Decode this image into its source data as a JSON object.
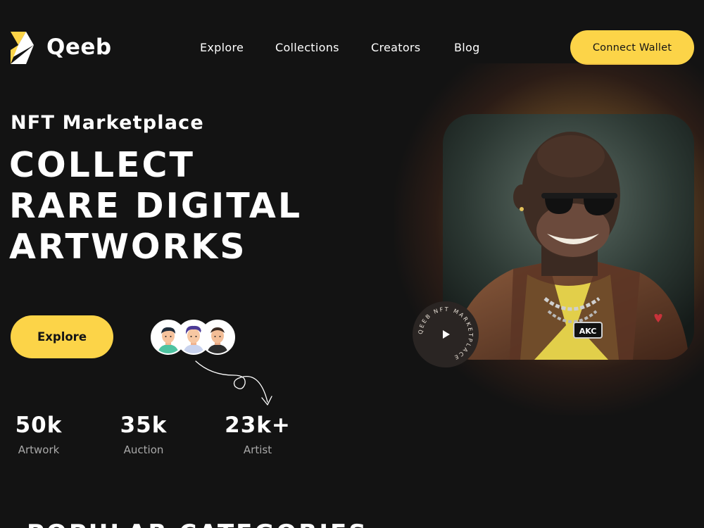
{
  "header": {
    "brand": "Qeeb",
    "logo_icon": "triangle-logo-icon",
    "nav": [
      "Explore",
      "Collections",
      "Creators",
      "Blog"
    ],
    "connect_label": "Connect Wallet"
  },
  "hero": {
    "eyebrow": "NFT Marketplace",
    "title_lines": [
      "COLLECT",
      "RARE DIGITAL",
      "ARTWORKS"
    ],
    "explore_label": "Explore",
    "avatar_icons": [
      "avatar-icon",
      "avatar-icon",
      "avatar-icon"
    ],
    "badge_text": "QEEB NFT MARKETPLACE",
    "badge_icon": "play-icon",
    "artwork_tag": "AKC"
  },
  "stats": [
    {
      "value": "50k",
      "label": "Artwork"
    },
    {
      "value": "35k",
      "label": "Auction"
    },
    {
      "value": "23k+",
      "label": "Artist"
    }
  ],
  "next_section": "POPULAR CATEGORIES",
  "colors": {
    "background": "#131313",
    "accent": "#fcd448",
    "text": "#ffffff",
    "muted": "#a9a9a9"
  }
}
